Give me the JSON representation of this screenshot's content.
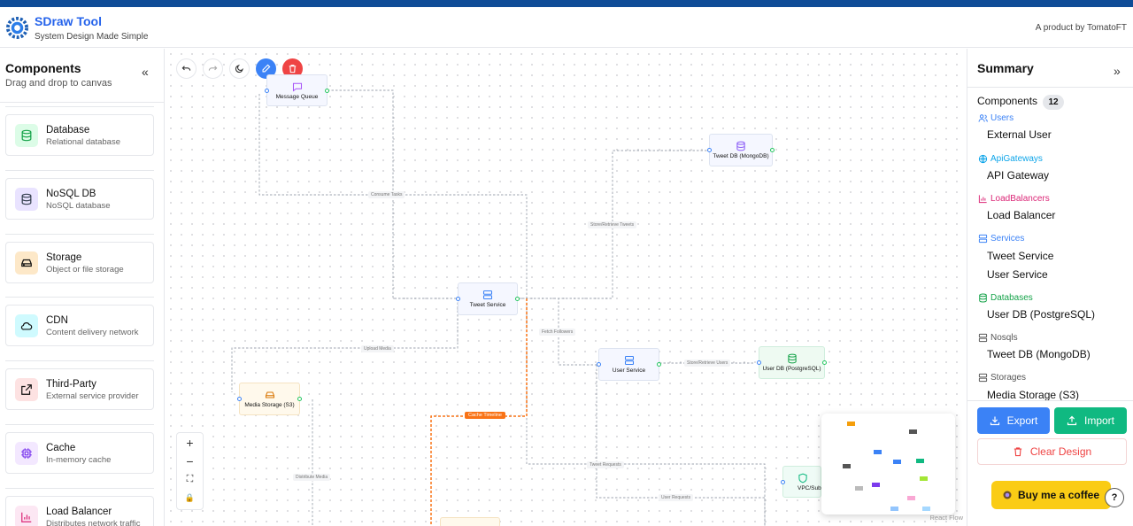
{
  "header": {
    "brand": "SDraw Tool",
    "tagline": "System Design Made Simple",
    "credit": "A product by TomatoFT"
  },
  "left_panel": {
    "title": "Components",
    "subtitle": "Drag and drop to canvas",
    "collapse": "«",
    "components": [
      {
        "name": "Database",
        "desc": "Relational database",
        "icon": "database-icon",
        "color": "#16a34a",
        "bg": "#dcfce7"
      },
      {
        "name": "NoSQL DB",
        "desc": "NoSQL database",
        "icon": "nosql-db-icon",
        "color": "#374151",
        "bg": "#e9e3ff"
      },
      {
        "name": "Storage",
        "desc": "Object or file storage",
        "icon": "hard-drive-icon",
        "color": "#b45309",
        "bg": "#fde8c8"
      },
      {
        "name": "CDN",
        "desc": "Content delivery network",
        "icon": "cloud-icon",
        "color": "#0e7490",
        "bg": "#cffafe"
      },
      {
        "name": "Third-Party",
        "desc": "External service provider",
        "icon": "external-link-icon",
        "color": "#b91c1c",
        "bg": "#fde2e2"
      },
      {
        "name": "Cache",
        "desc": "In-memory cache",
        "icon": "cpu-icon",
        "color": "#7c3aed",
        "bg": "#f3e8ff"
      },
      {
        "name": "Load Balancer",
        "desc": "Distributes network traffic",
        "icon": "bar-chart-icon",
        "color": "#db2777",
        "bg": "#fce7f3"
      }
    ]
  },
  "canvas": {
    "nodes": {
      "message_queue": "Message Queue",
      "tweet_db": "Tweet DB (MongoDB)",
      "tweet_service": "Tweet Service",
      "user_service": "User Service",
      "user_db": "User DB (PostgreSQL)",
      "media_storage": "Media Storage (S3)",
      "vpc": "VPC/Subn"
    },
    "edge_labels": {
      "consume_tasks": "Consume Tasks",
      "store_tweets": "Store/Retrieve Tweets",
      "fetch_followers": "Fetch Followers",
      "upload_media": "Upload Media",
      "store_users": "Store/Retrieve Users",
      "cache_timeline": "Cache Timeline",
      "distribute_media": "Distribute Media",
      "tweet_requests": "Tweet Requests",
      "user_requests": "User Requests"
    },
    "zoom_controls": [
      "+",
      "−",
      "⛶",
      "🔒"
    ],
    "attribution": "React Flow"
  },
  "right_panel": {
    "title": "Summary",
    "collapse": "»",
    "components_label": "Components",
    "components_count": "12",
    "categories": [
      {
        "label": "Users",
        "color": "#3b82f6",
        "icon": "users-icon",
        "items": [
          "External User"
        ]
      },
      {
        "label": "ApiGateways",
        "color": "#0ea5e9",
        "icon": "globe-icon",
        "items": [
          "API Gateway"
        ]
      },
      {
        "label": "LoadBalancers",
        "color": "#db2777",
        "icon": "bar-chart-icon",
        "items": [
          "Load Balancer"
        ]
      },
      {
        "label": "Services",
        "color": "#3b82f6",
        "icon": "server-icon",
        "items": [
          "Tweet Service",
          "User Service"
        ]
      },
      {
        "label": "Databases",
        "color": "#16a34a",
        "icon": "database-icon",
        "items": [
          "User DB (PostgreSQL)"
        ]
      },
      {
        "label": "Nosqls",
        "color": "#555555",
        "icon": "nosql-db-icon",
        "items": [
          "Tweet DB (MongoDB)"
        ]
      },
      {
        "label": "Storages",
        "color": "#555555",
        "icon": "hard-drive-icon",
        "items": [
          "Media Storage (S3)"
        ]
      }
    ],
    "export_label": "Export",
    "import_label": "Import",
    "clear_label": "Clear Design",
    "coffee_label": "Buy me a coffee",
    "help": "?"
  }
}
